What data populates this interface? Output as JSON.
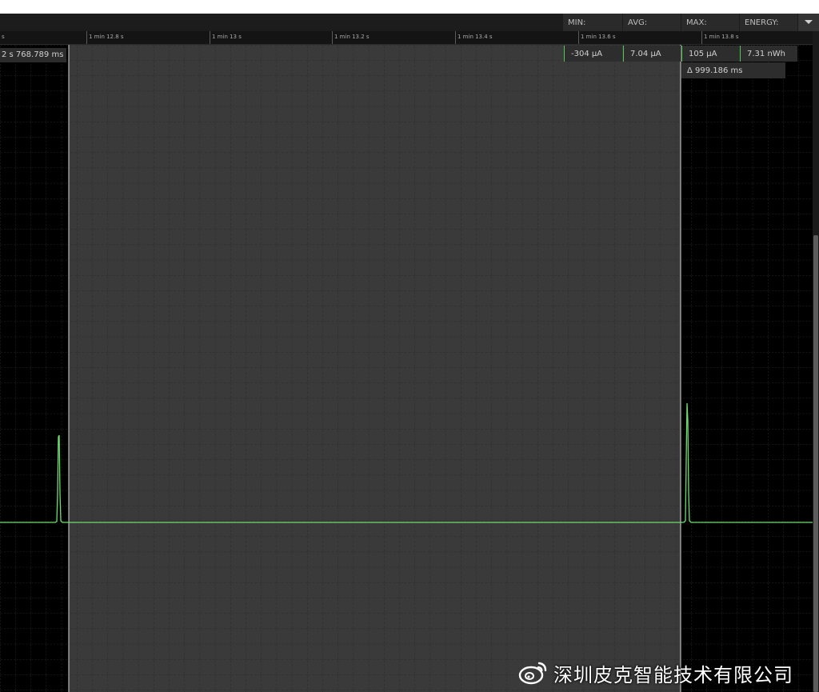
{
  "stats": {
    "min_label": "MIN:",
    "avg_label": "AVG:",
    "max_label": "MAX:",
    "energy_label": "ENERGY:",
    "min_value": "-304 µA",
    "avg_value": "7.04 µA",
    "max_value": "105 µA",
    "energy_value": "7.31 nWh",
    "delta": "Δ 999.186 ms"
  },
  "timeline": {
    "ticks": [
      "s",
      "1 min 12.8 s",
      "1 min 13 s",
      "1 min 13.2 s",
      "1 min 13.4 s",
      "1 min 13.6 s",
      "1 min 13.8 s"
    ]
  },
  "cursor": {
    "left_readout": "2 s 768.789 ms"
  },
  "colors": {
    "trace": "#6fdc6f",
    "background": "#000000",
    "selection": "#3a3a3a",
    "grid": "#3b3b3b"
  },
  "icons": {
    "dropdown": "chevron-down-icon",
    "watermark_logo": "weibo-icon"
  },
  "watermark": {
    "text": "深圳皮克智能技术有限公司"
  }
}
